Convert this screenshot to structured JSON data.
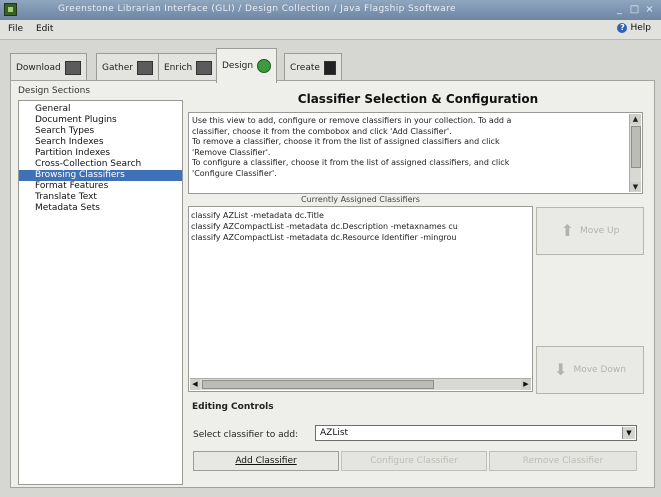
{
  "window": {
    "title": "Greenstone Librarian Interface (GLI) / Design Collection / Java Flagship Ssoftware"
  },
  "menu": {
    "file": "File",
    "edit": "Edit",
    "help": "Help"
  },
  "tabs": [
    {
      "label": "Download",
      "icon": "download-icon"
    },
    {
      "label": "Gather",
      "icon": "gather-icon"
    },
    {
      "label": "Enrich",
      "icon": "enrich-icon"
    },
    {
      "label": "Design",
      "icon": "design-icon",
      "active": true
    },
    {
      "label": "Create",
      "icon": "create-icon"
    }
  ],
  "sections": {
    "title": "Design Sections",
    "items": [
      "General",
      "Document Plugins",
      "Search Types",
      "Search Indexes",
      "Partition Indexes",
      "Cross-Collection Search",
      "Browsing Classifiers",
      "Format Features",
      "Translate Text",
      "Metadata Sets"
    ],
    "selected_index": 6
  },
  "main": {
    "heading": "Classifier Selection & Configuration",
    "instructions": [
      "Use this view to add, configure or remove classifiers in your collection. To add a",
      "classifier, choose it from the combobox and click 'Add Classifier'.",
      "To remove a classifier, choose it from the list of assigned classifiers and click",
      "'Remove Classifier'.",
      "To configure a classifier, choose it from the list of assigned classifiers, and click",
      "'Configure Classifier'."
    ]
  },
  "assigned": {
    "title": "Currently Assigned Classifiers",
    "rows": [
      "classify AZList -metadata dc.Title",
      "classify AZCompactList -metadata dc.Description -metaxnames cu",
      "classify AZCompactList -metadata dc.Resource Identifier -mingrou"
    ]
  },
  "move_up_label": "Move Up",
  "move_down_label": "Move Down",
  "editing": {
    "title": "Editing Controls",
    "select_label": "Select classifier to add:",
    "selected_value": "AZList"
  },
  "buttons": {
    "add": "Add Classifier",
    "configure": "Configure Classifier",
    "remove": "Remove Classifier"
  },
  "colors": {
    "selection": "#3f71b8",
    "titlebar": "#7a92ae",
    "design_tab_icon": "#3d9a3d"
  }
}
